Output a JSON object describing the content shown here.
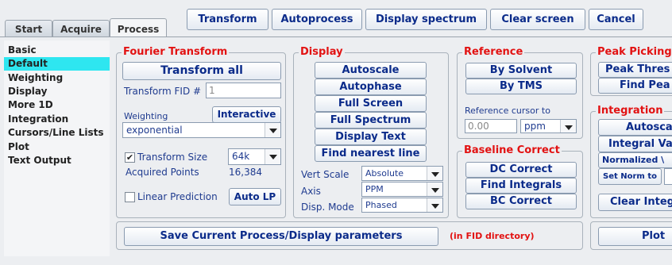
{
  "tabs": [
    {
      "label": "Start"
    },
    {
      "label": "Acquire"
    },
    {
      "label": "Process"
    }
  ],
  "toolbar": {
    "transform": "Transform",
    "autoprocess": "Autoprocess",
    "display_spectrum": "Display spectrum",
    "clear_screen": "Clear screen",
    "cancel": "Cancel"
  },
  "sidebar": {
    "items": [
      {
        "label": "Basic"
      },
      {
        "label": "Default"
      },
      {
        "label": "Weighting"
      },
      {
        "label": "Display"
      },
      {
        "label": "More 1D"
      },
      {
        "label": "Integration"
      },
      {
        "label": "Cursors/Line Lists"
      },
      {
        "label": "Plot"
      },
      {
        "label": "Text Output"
      }
    ]
  },
  "fourier": {
    "title": "Fourier Transform",
    "transform_all": "Transform all",
    "transform_fid_label": "Transform FID #",
    "transform_fid_value": "1",
    "weighting_label": "Weighting",
    "interactive": "Interactive",
    "weighting_value": "exponential",
    "transform_size_label": "Transform Size",
    "transform_size_value": "64k",
    "acquired_points_label": "Acquired Points",
    "acquired_points_value": "16,384",
    "linear_prediction_label": "Linear Prediction",
    "auto_lp": "Auto LP"
  },
  "display": {
    "title": "Display",
    "autoscale": "Autoscale",
    "autophase": "Autophase",
    "full_screen": "Full Screen",
    "full_spectrum": "Full Spectrum",
    "display_text": "Display Text",
    "find_nearest_line": "Find nearest line",
    "vert_scale_label": "Vert Scale",
    "vert_scale_value": "Absolute",
    "axis_label": "Axis",
    "axis_value": "PPM",
    "disp_mode_label": "Disp. Mode",
    "disp_mode_value": "Phased"
  },
  "reference": {
    "title": "Reference",
    "by_solvent": "By Solvent",
    "by_tms": "By TMS",
    "cursor_label": "Reference cursor to",
    "cursor_value": "0.00",
    "unit_value": "ppm"
  },
  "baseline": {
    "title": "Baseline Correct",
    "dc_correct": "DC Correct",
    "find_integrals": "Find Integrals",
    "bc_correct": "BC Correct"
  },
  "peak_picking": {
    "title": "Peak Picking",
    "peak_threshold": "Peak Thres",
    "find_peaks": "Find Pea"
  },
  "integration": {
    "title": "Integration",
    "autoscale": "Autosca",
    "integral_value": "Integral Va",
    "normalized": "Normalized \\",
    "set_norm_to": "Set Norm to"
  },
  "bottom": {
    "save_params": "Save Current Process/Display parameters",
    "in_fid_dir": "(in FID directory)",
    "plot": "Plot",
    "clear_integrals": "Clear Integ"
  }
}
